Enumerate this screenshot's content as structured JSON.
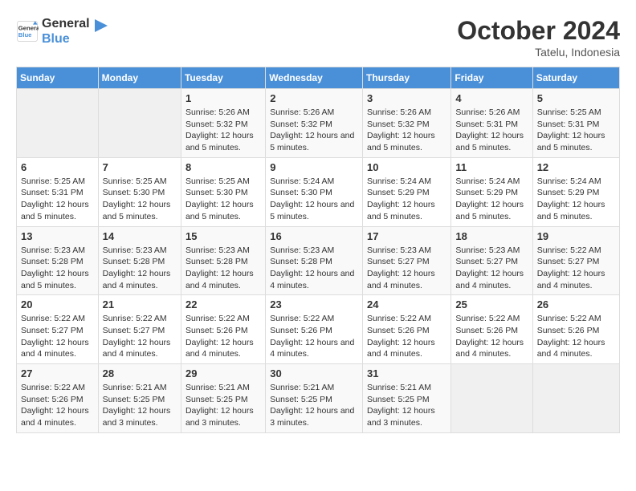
{
  "logo": {
    "line1": "General",
    "line2": "Blue"
  },
  "title": "October 2024",
  "location": "Tatelu, Indonesia",
  "days_of_week": [
    "Sunday",
    "Monday",
    "Tuesday",
    "Wednesday",
    "Thursday",
    "Friday",
    "Saturday"
  ],
  "weeks": [
    [
      {
        "day": "",
        "info": ""
      },
      {
        "day": "",
        "info": ""
      },
      {
        "day": "1",
        "info": "Sunrise: 5:26 AM\nSunset: 5:32 PM\nDaylight: 12 hours and 5 minutes."
      },
      {
        "day": "2",
        "info": "Sunrise: 5:26 AM\nSunset: 5:32 PM\nDaylight: 12 hours and 5 minutes."
      },
      {
        "day": "3",
        "info": "Sunrise: 5:26 AM\nSunset: 5:32 PM\nDaylight: 12 hours and 5 minutes."
      },
      {
        "day": "4",
        "info": "Sunrise: 5:26 AM\nSunset: 5:31 PM\nDaylight: 12 hours and 5 minutes."
      },
      {
        "day": "5",
        "info": "Sunrise: 5:25 AM\nSunset: 5:31 PM\nDaylight: 12 hours and 5 minutes."
      }
    ],
    [
      {
        "day": "6",
        "info": "Sunrise: 5:25 AM\nSunset: 5:31 PM\nDaylight: 12 hours and 5 minutes."
      },
      {
        "day": "7",
        "info": "Sunrise: 5:25 AM\nSunset: 5:30 PM\nDaylight: 12 hours and 5 minutes."
      },
      {
        "day": "8",
        "info": "Sunrise: 5:25 AM\nSunset: 5:30 PM\nDaylight: 12 hours and 5 minutes."
      },
      {
        "day": "9",
        "info": "Sunrise: 5:24 AM\nSunset: 5:30 PM\nDaylight: 12 hours and 5 minutes."
      },
      {
        "day": "10",
        "info": "Sunrise: 5:24 AM\nSunset: 5:29 PM\nDaylight: 12 hours and 5 minutes."
      },
      {
        "day": "11",
        "info": "Sunrise: 5:24 AM\nSunset: 5:29 PM\nDaylight: 12 hours and 5 minutes."
      },
      {
        "day": "12",
        "info": "Sunrise: 5:24 AM\nSunset: 5:29 PM\nDaylight: 12 hours and 5 minutes."
      }
    ],
    [
      {
        "day": "13",
        "info": "Sunrise: 5:23 AM\nSunset: 5:28 PM\nDaylight: 12 hours and 5 minutes."
      },
      {
        "day": "14",
        "info": "Sunrise: 5:23 AM\nSunset: 5:28 PM\nDaylight: 12 hours and 4 minutes."
      },
      {
        "day": "15",
        "info": "Sunrise: 5:23 AM\nSunset: 5:28 PM\nDaylight: 12 hours and 4 minutes."
      },
      {
        "day": "16",
        "info": "Sunrise: 5:23 AM\nSunset: 5:28 PM\nDaylight: 12 hours and 4 minutes."
      },
      {
        "day": "17",
        "info": "Sunrise: 5:23 AM\nSunset: 5:27 PM\nDaylight: 12 hours and 4 minutes."
      },
      {
        "day": "18",
        "info": "Sunrise: 5:23 AM\nSunset: 5:27 PM\nDaylight: 12 hours and 4 minutes."
      },
      {
        "day": "19",
        "info": "Sunrise: 5:22 AM\nSunset: 5:27 PM\nDaylight: 12 hours and 4 minutes."
      }
    ],
    [
      {
        "day": "20",
        "info": "Sunrise: 5:22 AM\nSunset: 5:27 PM\nDaylight: 12 hours and 4 minutes."
      },
      {
        "day": "21",
        "info": "Sunrise: 5:22 AM\nSunset: 5:27 PM\nDaylight: 12 hours and 4 minutes."
      },
      {
        "day": "22",
        "info": "Sunrise: 5:22 AM\nSunset: 5:26 PM\nDaylight: 12 hours and 4 minutes."
      },
      {
        "day": "23",
        "info": "Sunrise: 5:22 AM\nSunset: 5:26 PM\nDaylight: 12 hours and 4 minutes."
      },
      {
        "day": "24",
        "info": "Sunrise: 5:22 AM\nSunset: 5:26 PM\nDaylight: 12 hours and 4 minutes."
      },
      {
        "day": "25",
        "info": "Sunrise: 5:22 AM\nSunset: 5:26 PM\nDaylight: 12 hours and 4 minutes."
      },
      {
        "day": "26",
        "info": "Sunrise: 5:22 AM\nSunset: 5:26 PM\nDaylight: 12 hours and 4 minutes."
      }
    ],
    [
      {
        "day": "27",
        "info": "Sunrise: 5:22 AM\nSunset: 5:26 PM\nDaylight: 12 hours and 4 minutes."
      },
      {
        "day": "28",
        "info": "Sunrise: 5:21 AM\nSunset: 5:25 PM\nDaylight: 12 hours and 3 minutes."
      },
      {
        "day": "29",
        "info": "Sunrise: 5:21 AM\nSunset: 5:25 PM\nDaylight: 12 hours and 3 minutes."
      },
      {
        "day": "30",
        "info": "Sunrise: 5:21 AM\nSunset: 5:25 PM\nDaylight: 12 hours and 3 minutes."
      },
      {
        "day": "31",
        "info": "Sunrise: 5:21 AM\nSunset: 5:25 PM\nDaylight: 12 hours and 3 minutes."
      },
      {
        "day": "",
        "info": ""
      },
      {
        "day": "",
        "info": ""
      }
    ]
  ]
}
